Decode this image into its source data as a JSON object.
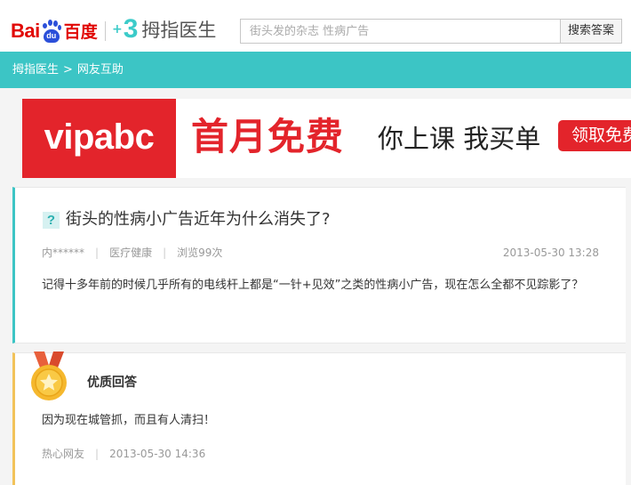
{
  "header": {
    "baidu_logo_latin": "Bai",
    "baidu_logo_paw_text": "du",
    "baidu_logo_cn": "百度",
    "muzhi_logo_plus": "+",
    "muzhi_logo_mark": "3",
    "muzhi_logo_text": "拇指医生",
    "search_placeholder": "街头发的杂志 性病广告",
    "search_button_label": "搜索答案"
  },
  "breadcrumb": {
    "home": "拇指医生",
    "separator": ">",
    "current": "网友互助"
  },
  "ad": {
    "brand": "vipabc",
    "headline": "首月免费",
    "slogan": "你上课 我买单",
    "cta": "领取免费"
  },
  "question": {
    "icon_text": "?",
    "title": "街头的性病小广告近年为什么消失了?",
    "author": "内******",
    "category": "医疗健康",
    "views": "浏览99次",
    "time": "2013-05-30 13:28",
    "body": "记得十多年前的时候几乎所有的电线杆上都是“一针+见效”之类的性病小广告，现在怎么全都不见踪影了？"
  },
  "answer": {
    "label": "优质回答",
    "body": "因为现在城管抓，而且有人清扫！",
    "author": "热心网友",
    "time": "2013-05-30 14:36"
  },
  "colors": {
    "accent_teal": "#3cc5c5",
    "baidu_red": "#e10602",
    "baidu_blue": "#2b4fd9",
    "ad_red": "#e3242b",
    "medal_gold": "#f2c35a"
  }
}
